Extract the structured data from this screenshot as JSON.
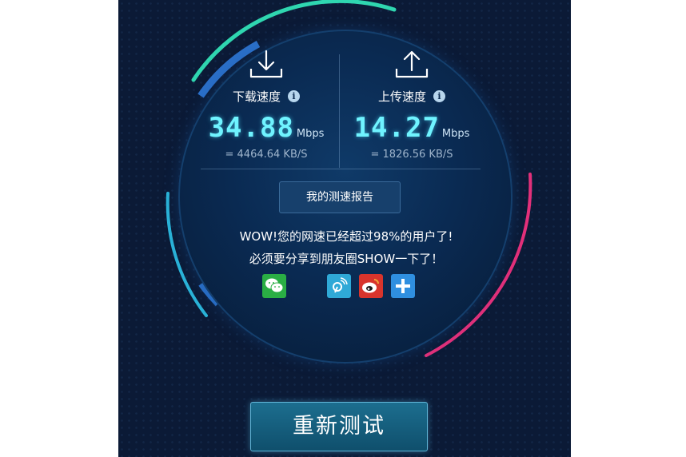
{
  "download": {
    "label": "下载速度",
    "speed": "34.88",
    "unit": "Mbps",
    "kbs": "= 4464.64  KB/S"
  },
  "upload": {
    "label": "上传速度",
    "speed": "14.27",
    "unit": "Mbps",
    "kbs": "= 1826.56  KB/S"
  },
  "report_button": "我的测速报告",
  "message_line1": "WOW!您的网速已经超过98%的用户了!",
  "message_line2": "必须要分享到朋友圈SHOW一下了！",
  "share_icons": [
    "wechat-icon",
    "tencent-weibo-icon",
    "sina-weibo-icon",
    "more-share-icon"
  ],
  "retest_button": "重新测试",
  "colors": {
    "background": "#0b1a36",
    "speed_text": "#6ff3ff",
    "ring_green": "#2fd6b0",
    "ring_blue": "#2b8fd8",
    "ring_pink": "#e2307a",
    "wechat": "#2aae44",
    "tencent_weibo": "#2fa9d7",
    "sina_weibo": "#d8342c",
    "more": "#2f8fe0"
  }
}
